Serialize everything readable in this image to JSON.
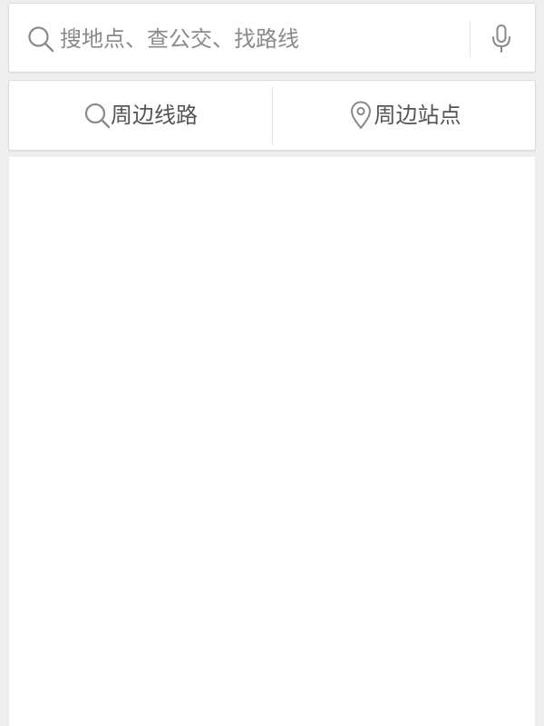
{
  "search": {
    "placeholder": "搜地点、查公交、找路线",
    "search_icon": "search-icon",
    "voice_icon": "microphone-icon"
  },
  "nearby": {
    "routes_label": "周边线路",
    "routes_icon": "search-icon",
    "stations_label": "周边站点",
    "stations_icon": "map-pin-icon"
  },
  "colors": {
    "background": "#eeeeee",
    "card": "#ffffff",
    "icon": "#8a8a8a",
    "label": "#555555"
  }
}
